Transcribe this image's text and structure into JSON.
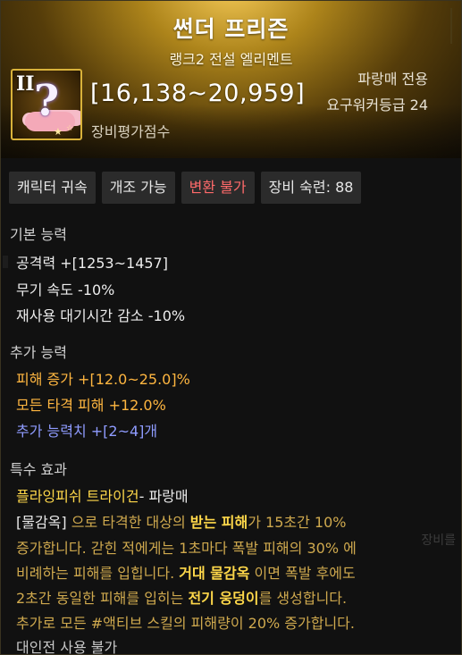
{
  "item": {
    "name": "썬더 프리즌",
    "rarity": "랭크2 전설 엘리멘트",
    "icon_rank": "II",
    "score_range": "[16,138~20,959]",
    "score_label": "장비평가점수",
    "class_only": "파랑매 전용",
    "required_level": "요구워커등급 24"
  },
  "tags": [
    {
      "label": "캐릭터 귀속",
      "color": "#e6e6e6"
    },
    {
      "label": "개조 가능",
      "color": "#e6e6e6"
    },
    {
      "label": "변환 불가",
      "color": "#ff6a6a"
    },
    {
      "label": "장비 숙련: 88",
      "color": "#e6e6e6"
    }
  ],
  "basic": {
    "title": "기본 능력",
    "lines": [
      "공격력  +[1253~1457]",
      "무기 속도 -10%",
      "재사용 대기시간 감소 -10%"
    ]
  },
  "extra": {
    "title": "추가 능력",
    "lines": [
      "피해 증가  +[12.0~25.0]%",
      "모든 타격 피해  +12.0%",
      "추가 능력치 +[2~4]개"
    ]
  },
  "special": {
    "title": "특수 효과",
    "skill": "플라잉피쉬 트라이건",
    "skill_suffix": "- 파랑매",
    "desc": {
      "l1_a": "[물감옥]",
      "l1_b": " 으로 타격한 대상의 ",
      "l1_c": "받는 피해",
      "l1_d": "가 15초간 10%",
      "l2": "증가합니다. 갇힌 적에게는 1초마다 폭발 피해의 30% 에",
      "l3_a": "비례하는 피해를 입힙니다. ",
      "l3_b": "거대 물감옥",
      "l3_c": " 이면 폭발 후에도",
      "l4_a": "2초간 동일한 피해를 입히는 ",
      "l4_b": "전기 웅덩이",
      "l4_c": "를 생성합니다.",
      "l5": "추가로 모든 #액티브 스킬의 피해량이 20% 증가합니다."
    },
    "pvp": "대인전 사용 불가"
  },
  "ghost_right": "장비를",
  "colors": {
    "gold": "#d9b23a",
    "tag_red": "#ff6a6a",
    "orange": "#ffb640",
    "blue": "#8f9cff",
    "yellow": "#ffd84a",
    "tan": "#cfa94e"
  }
}
